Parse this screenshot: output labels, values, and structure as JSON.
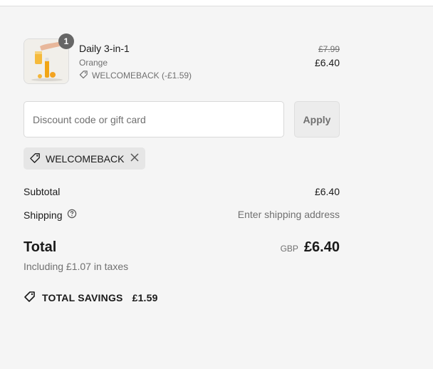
{
  "product": {
    "name": "Daily 3-in-1",
    "variant": "Orange",
    "discount_label": "WELCOMEBACK (-£1.59)",
    "quantity": "1",
    "original_price": "£7.99",
    "price": "£6.40"
  },
  "discount": {
    "placeholder": "Discount code or gift card",
    "value": "",
    "apply_label": "Apply",
    "applied_code": "WELCOMEBACK"
  },
  "summary": {
    "subtotal_label": "Subtotal",
    "subtotal_value": "£6.40",
    "shipping_label": "Shipping",
    "shipping_value": "Enter shipping address",
    "total_label": "Total",
    "currency": "GBP",
    "total_value": "£6.40",
    "taxes_note": "Including £1.07 in taxes",
    "savings_label": "TOTAL SAVINGS",
    "savings_value": "£1.59"
  },
  "icons": {
    "tag": "tag-icon",
    "close": "close-icon",
    "help": "help-circle-icon",
    "savings": "savings-tag-icon"
  }
}
